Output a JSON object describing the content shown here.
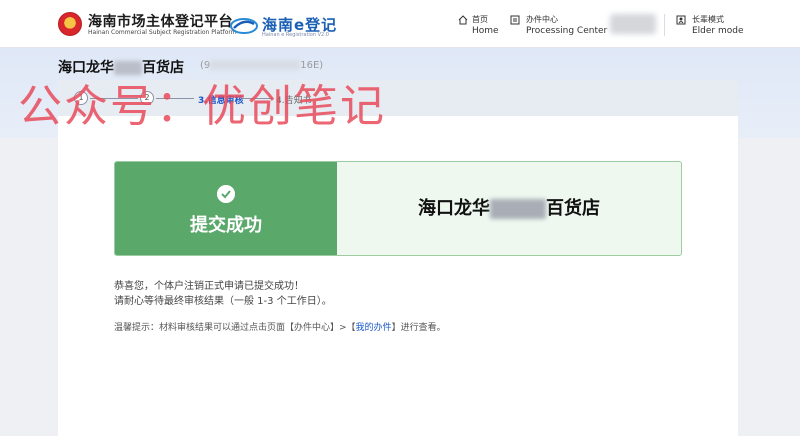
{
  "header": {
    "site_title": "海南市场主体登记平台",
    "site_subtitle": "Hainan Commercial Subject Registration Platform",
    "e_title": "海南e登记",
    "e_subtitle": "Hainan e Registration V2.0",
    "nav": {
      "home_zh": "首页",
      "home_en": "Home",
      "processing_zh": "办件中心",
      "processing_en": "Processing Center",
      "elder_zh": "长辈模式",
      "elder_en": "Elder mode"
    }
  },
  "company": {
    "name_prefix": "海口龙华",
    "name_suffix": "百货店",
    "code_prefix": "(9",
    "code_suffix": "16E)"
  },
  "steps": [
    {
      "label": "1",
      "state": "done"
    },
    {
      "label": "2",
      "state": "done"
    },
    {
      "label": "3.信息审核",
      "state": "active"
    },
    {
      "label": "4.告知书",
      "state": "pending"
    }
  ],
  "result": {
    "status_text": "提交成功",
    "company_prefix": "海口龙华",
    "company_suffix": "百货店"
  },
  "messages": {
    "line1": "恭喜您，个体户注销正式申请已提交成功！",
    "line2": "请耐心等待最终审核结果（一般 1-3 个工作日）。",
    "tip_prefix": "温馨提示：材料审核结果可以通过点击页面【办件中心】>【",
    "tip_link": "我的办件",
    "tip_suffix": "】进行查看。"
  },
  "watermark": "公众号：优创笔记",
  "colors": {
    "success_green": "#5aa86a",
    "link_blue": "#1a56c9",
    "watermark_red": "#e84a5a"
  }
}
